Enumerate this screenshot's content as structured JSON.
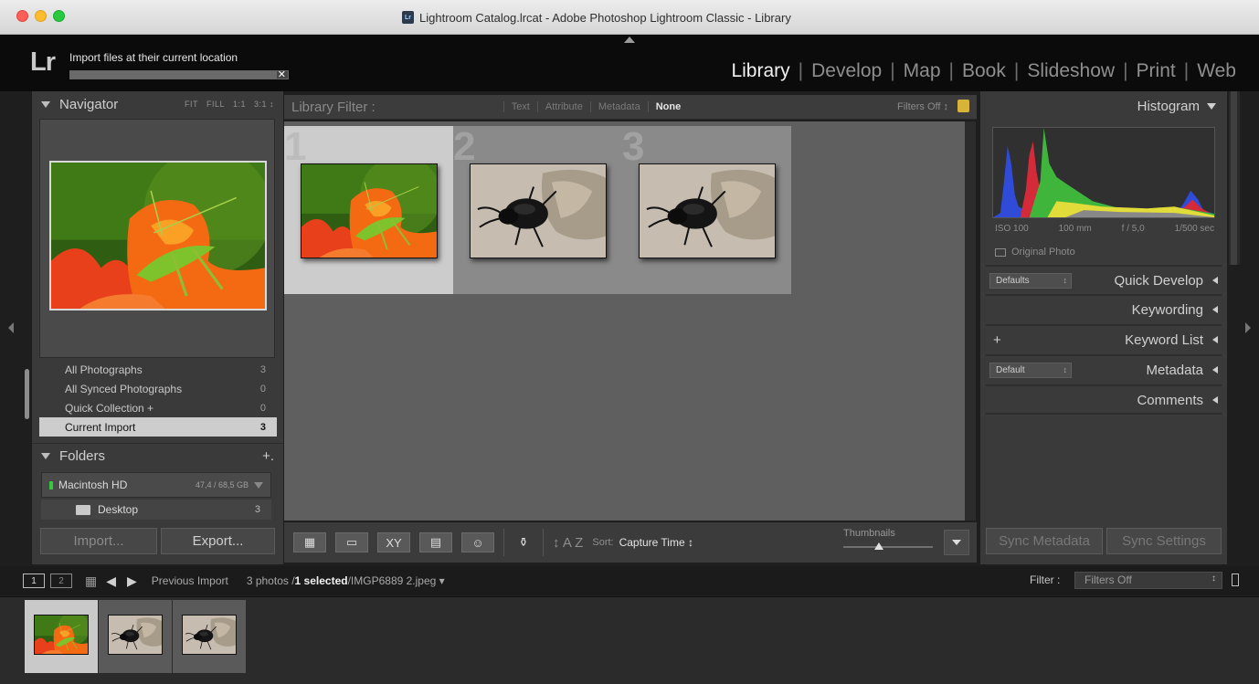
{
  "window": {
    "title": "Lightroom Catalog.lrcat - Adobe Photoshop Lightroom Classic - Library",
    "doc_icon": "Lr"
  },
  "identity": {
    "logo": "Lr",
    "import_status": "Import files at their current location",
    "import_progress": 0.95
  },
  "modules": [
    {
      "label": "Library",
      "active": true
    },
    {
      "label": "Develop",
      "active": false
    },
    {
      "label": "Map",
      "active": false
    },
    {
      "label": "Book",
      "active": false
    },
    {
      "label": "Slideshow",
      "active": false
    },
    {
      "label": "Print",
      "active": false
    },
    {
      "label": "Web",
      "active": false
    }
  ],
  "left_panel": {
    "navigator_title": "Navigator",
    "zoom_options": [
      "FIT",
      "FILL",
      "1:1",
      "3:1 ↕"
    ],
    "catalog": [
      {
        "label": "All Photographs",
        "count": "3",
        "selected": false
      },
      {
        "label": "All Synced Photographs",
        "count": "0",
        "selected": false
      },
      {
        "label": "Quick Collection +",
        "count": "0",
        "selected": false
      },
      {
        "label": "Current Import",
        "count": "3",
        "selected": true
      }
    ],
    "folders_title": "Folders",
    "folders_add": "+.",
    "volume": {
      "name": "Macintosh HD",
      "size": "47,4 / 68,5 GB"
    },
    "folder": {
      "name": "Desktop",
      "count": "3"
    },
    "import_label": "Import...",
    "export_label": "Export..."
  },
  "filter_bar": {
    "title": "Library Filter :",
    "options": [
      {
        "label": "Text",
        "active": false
      },
      {
        "label": "Attribute",
        "active": false
      },
      {
        "label": "Metadata",
        "active": false
      },
      {
        "label": "None",
        "active": true
      }
    ],
    "preset": "Filters Off ↕"
  },
  "grid": {
    "cells": [
      {
        "index": "1",
        "selected": true,
        "image": "grasshopper-on-flower"
      },
      {
        "index": "2",
        "selected": false,
        "image": "beetle-on-stone"
      },
      {
        "index": "3",
        "selected": false,
        "image": "beetle-on-stone"
      }
    ]
  },
  "toolbar": {
    "sort_label": "Sort:",
    "sort_value": "Capture Time ↕",
    "sort_icon": "↕ A Z",
    "thumbnails_label": "Thumbnails",
    "view_icons": [
      "grid-view-icon",
      "loupe-view-icon",
      "compare-view-icon",
      "survey-view-icon",
      "people-view-icon"
    ]
  },
  "right_panel": {
    "histogram_title": "Histogram",
    "exif": [
      "ISO 100",
      "100 mm",
      "f / 5,0",
      "1/500 sec"
    ],
    "original_photo": "Original Photo",
    "sections": [
      {
        "name": "Quick Develop",
        "preset": "Defaults"
      },
      {
        "name": "Keywording"
      },
      {
        "name": "Keyword List",
        "plus": "+"
      },
      {
        "name": "Metadata",
        "preset": "Default"
      },
      {
        "name": "Comments"
      }
    ],
    "sync_metadata": "Sync Metadata",
    "sync_settings": "Sync Settings"
  },
  "filmstrip": {
    "screen1": "1",
    "screen2": "2",
    "source": "Previous Import",
    "count": "3 photos /",
    "selected": "1 selected",
    "filename": "/IMGP6889 2.jpeg ▾",
    "filter_label": "Filter :",
    "filter_value": "Filters Off",
    "thumbs": [
      {
        "selected": true,
        "image": "grasshopper-on-flower"
      },
      {
        "selected": false,
        "image": "beetle-on-stone"
      },
      {
        "selected": false,
        "image": "beetle-on-stone"
      }
    ]
  },
  "colors": {
    "panel_bg": "#3a3a3a",
    "grid_bg": "#5f5f5f",
    "selected_cell": "#cccccc",
    "active_module": "#f1f1f1"
  }
}
